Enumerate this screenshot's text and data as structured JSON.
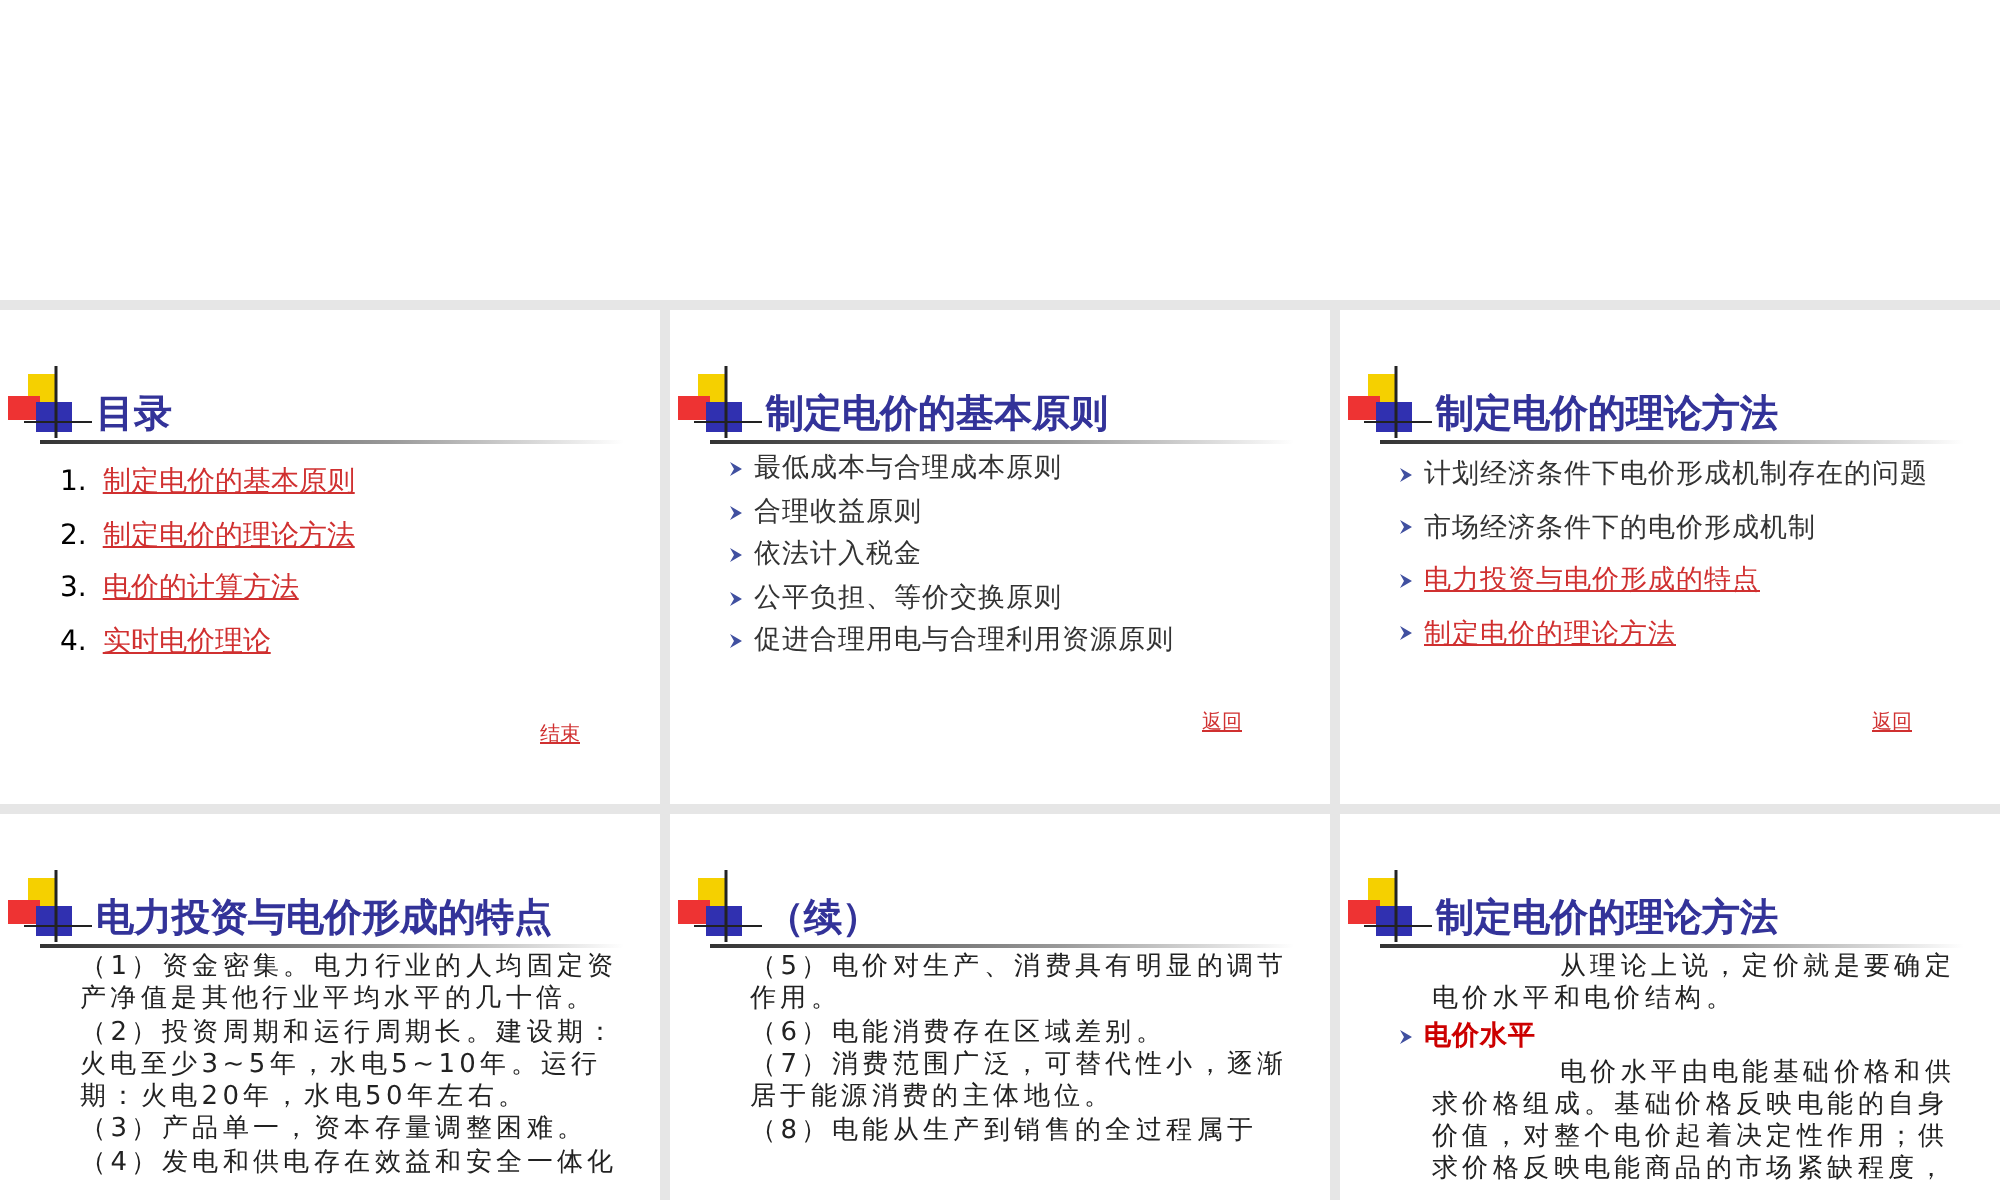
{
  "slides": [
    {
      "title": "目录",
      "items": [
        {
          "kind": "numbered",
          "number": "1.",
          "text": "制定电价的基本原则",
          "link": true
        },
        {
          "kind": "numbered",
          "number": "2.",
          "text": "制定电价的理论方法",
          "link": true
        },
        {
          "kind": "numbered",
          "number": "3.",
          "text": "电价的计算方法",
          "link": true
        },
        {
          "kind": "numbered",
          "number": "4.",
          "text": "实时电价理论",
          "link": true
        }
      ],
      "footer_link": "结束"
    },
    {
      "title": "制定电价的基本原则",
      "items": [
        {
          "kind": "bullet",
          "text": "最低成本与合理成本原则",
          "link": false
        },
        {
          "kind": "bullet",
          "text": "合理收益原则",
          "link": false
        },
        {
          "kind": "bullet",
          "text": "依法计入税金",
          "link": false
        },
        {
          "kind": "bullet",
          "text": "公平负担、等价交换原则",
          "link": false
        },
        {
          "kind": "bullet",
          "text": "促进合理用电与合理利用资源原则",
          "link": false
        }
      ],
      "footer_link": "返回"
    },
    {
      "title": "制定电价的理论方法",
      "items": [
        {
          "kind": "bullet",
          "text": "计划经济条件下电价形成机制存在的问题",
          "link": false
        },
        {
          "kind": "bullet",
          "text": "市场经济条件下的电价形成机制",
          "link": false
        },
        {
          "kind": "bullet",
          "text": "电力投资与电价形成的特点",
          "link": true
        },
        {
          "kind": "bullet",
          "text": "制定电价的理论方法",
          "link": true
        }
      ],
      "footer_link": "返回"
    },
    {
      "title": "电力投资与电价形成的特点",
      "items": [
        {
          "kind": "paragraph",
          "text": "（1）资金密集。电力行业的人均固定资产净值是其他行业平均水平的几十倍。"
        },
        {
          "kind": "paragraph",
          "text": "（2）投资周期和运行周期长。建设期：火电至少3~5年，水电5~10年。运行期：火电20年，水电50年左右。"
        },
        {
          "kind": "paragraph",
          "text": "（3）产品单一，资本存量调整困难。"
        },
        {
          "kind": "paragraph",
          "text": "（4）发电和供电存在效益和安全一体化"
        }
      ]
    },
    {
      "title": "（续）",
      "items": [
        {
          "kind": "paragraph",
          "text": "（5）电价对生产、消费具有明显的调节作用。"
        },
        {
          "kind": "paragraph",
          "text": "（6）电能消费存在区域差别。"
        },
        {
          "kind": "paragraph",
          "text": "（7）消费范围广泛，可替代性小，逐渐居于能源消费的主体地位。"
        },
        {
          "kind": "paragraph",
          "text": "（8）电能从生产到销售的全过程属于"
        }
      ]
    },
    {
      "title": "制定电价的理论方法",
      "items": [
        {
          "kind": "indented",
          "text": "从理论上说，定价就是要确定电价水平和电价结构。"
        },
        {
          "kind": "subheading",
          "text": "电价水平"
        },
        {
          "kind": "indented",
          "text": "电价水平由电能基础价格和供求价格组成。基础价格反映电能的自身价值，对整个电价起着决定性作用；供求价格反映电能商品的市场紧缺程度，"
        }
      ]
    }
  ]
}
